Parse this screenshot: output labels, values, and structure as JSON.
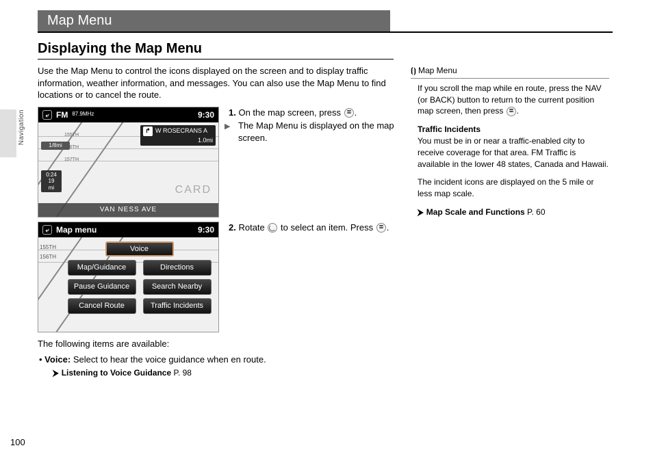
{
  "chapter": "Map Menu",
  "section": "Displaying the Map Menu",
  "side_label": "Navigation",
  "page_number": "100",
  "intro": "Use the Map Menu to control the icons displayed on the screen and to display traffic information, weather information, and messages. You can also use the Map Menu to find locations or to cancel the route.",
  "steps": [
    {
      "num": "1.",
      "text": "On the map screen, press ",
      "tail": ".",
      "sub": "The Map Menu is displayed on the map screen."
    },
    {
      "num": "2.",
      "text": "Rotate ",
      "mid": " to select an item. Press ",
      "tail": "."
    }
  ],
  "follow_head": "The following items are available:",
  "bullet_label": "Voice:",
  "bullet_text": " Select to hear the voice guidance when en route.",
  "xref1_label": "Listening to Voice Guidance",
  "xref1_page": " P. 98",
  "shot1": {
    "bar_left": "FM",
    "bar_freq": "87.9MHz",
    "clock": "9:30",
    "turn_label": "W ROSECRANS A",
    "turn_dist": "1.0mi",
    "dist1": "1/8mi",
    "info_time": "0:24",
    "info_mi": "19",
    "info_unit": "mi",
    "footer": "VAN NESS AVE",
    "card": "CARD",
    "streets": {
      "a": "155TH",
      "b": "156TH",
      "c": "157TH"
    }
  },
  "shot2": {
    "bar_title": "Map menu",
    "clock": "9:30",
    "btns": {
      "voice": "Voice",
      "map": "Map/Guidance",
      "dir": "Directions",
      "pause": "Pause Guidance",
      "search": "Search Nearby",
      "cancel": "Cancel Route",
      "traffic": "Traffic Incidents"
    },
    "side": {
      "a": "155TH",
      "b": "156TH"
    }
  },
  "sidebar": {
    "title": "Map Menu",
    "p1": "If you scroll the map while en route, press the NAV (or BACK) button to return to the current position map screen, then press ",
    "p1_tail": ".",
    "sub": "Traffic Incidents",
    "p2": "You must be in or near a traffic-enabled city to receive coverage for that area. FM Traffic is available in the lower 48 states, Canada and Hawaii.",
    "p3": "The incident icons are displayed on the 5 mile or less map scale.",
    "xref_label": "Map Scale and Functions",
    "xref_page": " P. 60"
  }
}
